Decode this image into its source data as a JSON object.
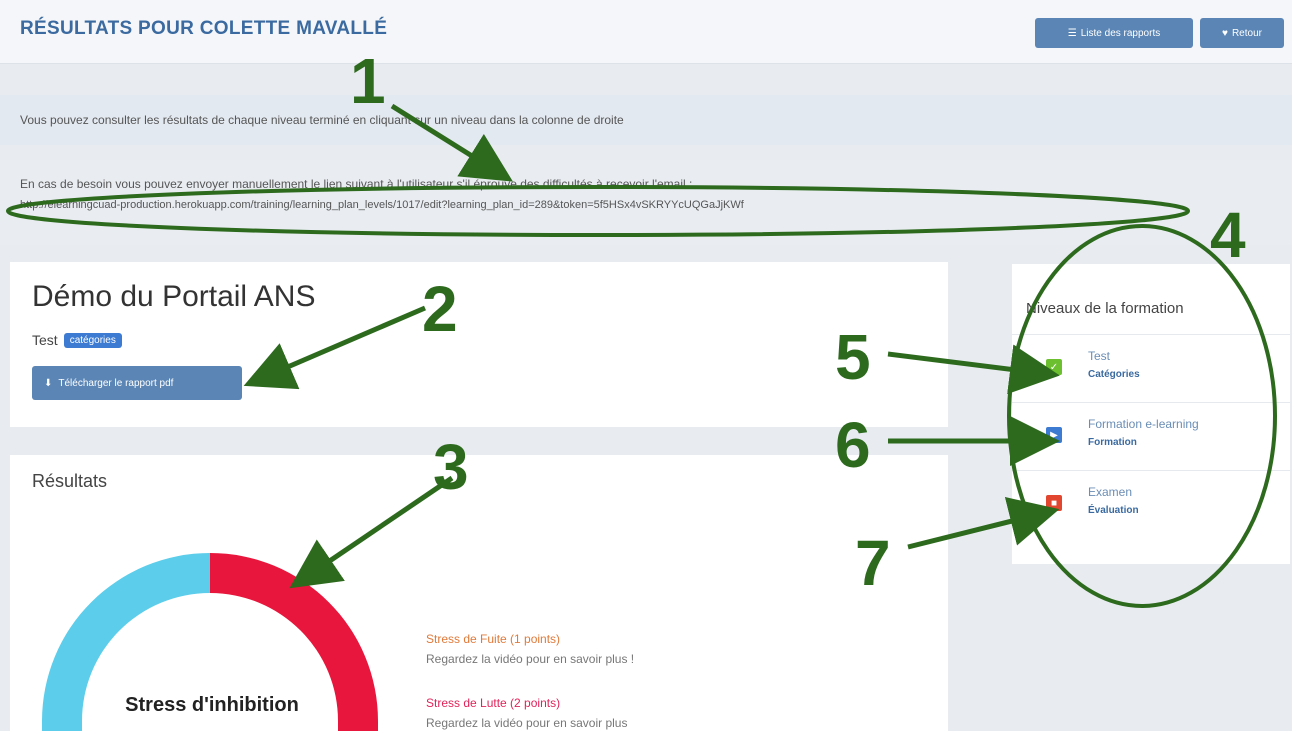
{
  "header": {
    "title": "RÉSULTATS POUR COLETTE MAVALLÉ",
    "reports_button": "Liste des rapports",
    "back_button": "Retour"
  },
  "info": {
    "line1": "Vous pouvez consulter les résultats de chaque niveau terminé en cliquant sur un niveau dans la colonne de droite",
    "line2": "En cas de besoin vous pouvez envoyer manuellement le lien suivant à l'utilisateur s'il éprouve des difficultés à recevoir l'email :",
    "link": "http://elearningcuad-production.herokuapp.com/training/learning_plan_levels/1017/edit?learning_plan_id=289&token=5f5HSx4vSKRYYcUQGaJjKWf"
  },
  "course": {
    "title": "Démo du Portail ANS",
    "subtitle": "Test",
    "badge": "catégories",
    "pdf_button": "Télécharger le rapport pdf"
  },
  "results": {
    "title": "Résultats",
    "donut_label": "Stress d'inhibition",
    "legend": [
      {
        "title": "Stress de Fuite (1 points)",
        "desc": "Regardez la vidéo pour en savoir plus !",
        "color": "#e07a3a"
      },
      {
        "title": "Stress de Lutte (2 points)",
        "desc": "Regardez la vidéo pour en savoir plus",
        "color": "#e0245a"
      }
    ]
  },
  "sidebar": {
    "title": "Niveaux de la formation",
    "levels": [
      {
        "name": "Test",
        "type": "Catégories",
        "icon": "check-icon",
        "color": "#6cbf2f"
      },
      {
        "name": "Formation e-learning",
        "type": "Formation",
        "icon": "play-icon",
        "color": "#3c7bd1"
      },
      {
        "name": "Examen",
        "type": "Évaluation",
        "icon": "quiz-icon",
        "color": "#e2462f"
      }
    ]
  },
  "annotations": [
    "1",
    "2",
    "3",
    "4",
    "5",
    "6",
    "7"
  ],
  "colors": {
    "annotation": "#2d6a1e",
    "donut_left": "#5ccdea",
    "donut_right": "#e8163c"
  }
}
